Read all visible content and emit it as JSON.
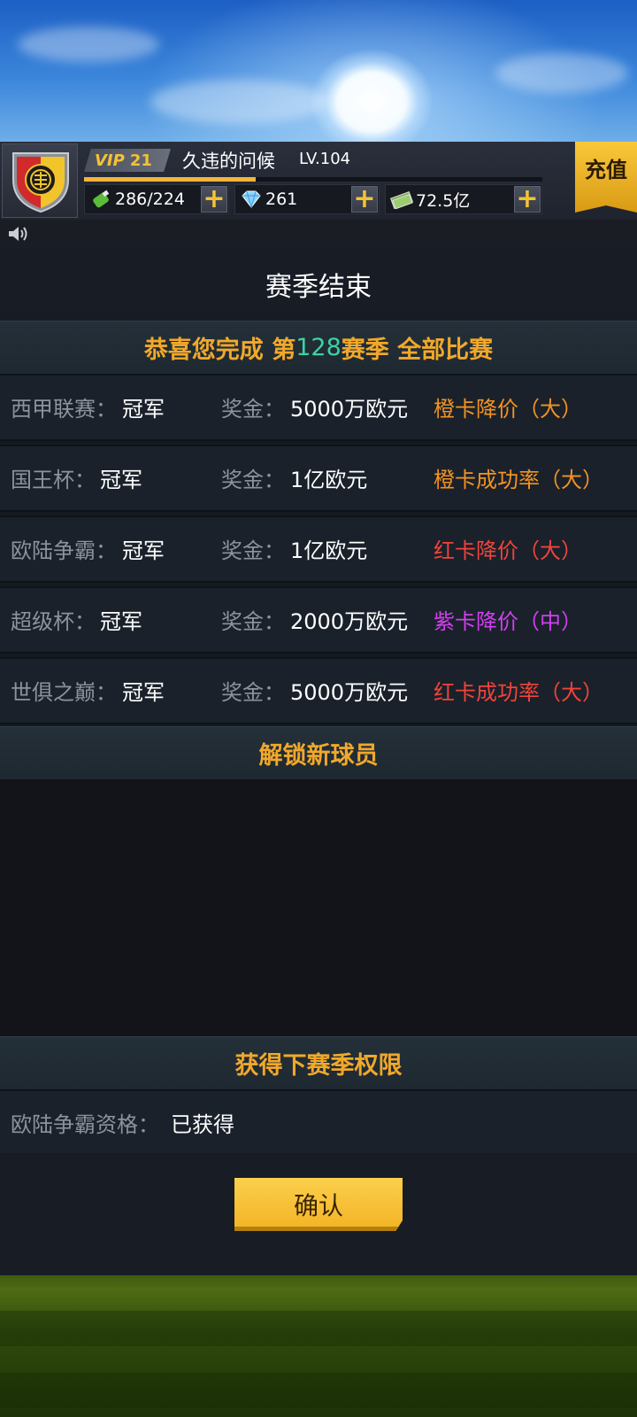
{
  "header": {
    "vip_label": "VIP",
    "vip_level": "21",
    "player_name": "久违的问候",
    "player_level": "LV.104",
    "xp_progress": 0.375,
    "stamina": "286/224",
    "diamonds": "261",
    "money": "72.5亿",
    "plus_label": "+",
    "recharge_label": "充值"
  },
  "panel": {
    "title": "赛季结束",
    "congrats": {
      "prefix": "恭喜您完成 第",
      "season": "128",
      "suffix": "赛季 全部比赛"
    },
    "results": [
      {
        "competition": "西甲联赛：",
        "result": "冠军",
        "prize_label": "奖金：",
        "prize": "5000万欧元",
        "reward": "橙卡降价（大）",
        "reward_color": "#f39321"
      },
      {
        "competition": "国王杯：",
        "result": "冠军",
        "prize_label": "奖金：",
        "prize": "1亿欧元",
        "reward": "橙卡成功率（大）",
        "reward_color": "#f39321"
      },
      {
        "competition": "欧陆争霸：",
        "result": "冠军",
        "prize_label": "奖金：",
        "prize": "1亿欧元",
        "reward": "红卡降价（大）",
        "reward_color": "#f0443a"
      },
      {
        "competition": "超级杯：",
        "result": "冠军",
        "prize_label": "奖金：",
        "prize": "2000万欧元",
        "reward": "紫卡降价（中）",
        "reward_color": "#d23ff0"
      },
      {
        "competition": "世俱之巅：",
        "result": "冠军",
        "prize_label": "奖金：",
        "prize": "5000万欧元",
        "reward": "红卡成功率（大）",
        "reward_color": "#f0443a"
      }
    ],
    "unlock_heading": "解锁新球员",
    "next_season_heading": "获得下赛季权限",
    "qualification_label": "欧陆争霸资格：",
    "qualification_value": "已获得",
    "confirm_label": "确认"
  },
  "colors": {
    "accent_gold": "#f1a82a",
    "highlight_green": "#3fd1a3"
  },
  "icons": [
    "club-crest-icon",
    "stamina-bottle-icon",
    "diamond-icon",
    "cash-icon",
    "speaker-icon",
    "plus-icon"
  ]
}
